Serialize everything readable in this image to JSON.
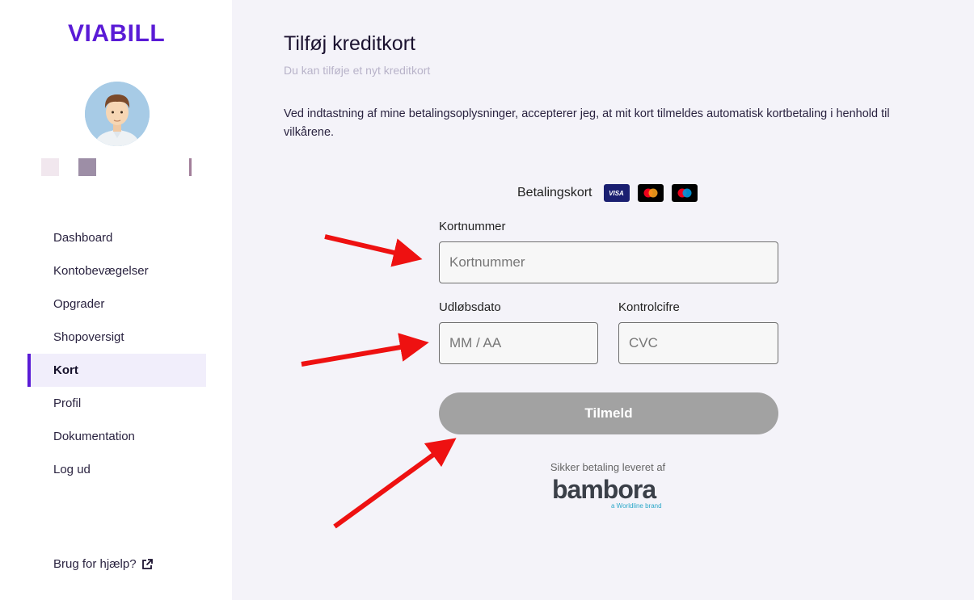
{
  "brand": {
    "logo_text": "VIABILL",
    "accent_color": "#5a1bd6"
  },
  "sidebar": {
    "nav": [
      {
        "label": "Dashboard"
      },
      {
        "label": "Kontobevægelser"
      },
      {
        "label": "Opgrader"
      },
      {
        "label": "Shopoversigt"
      },
      {
        "label": "Kort",
        "active": true
      },
      {
        "label": "Profil"
      },
      {
        "label": "Dokumentation"
      },
      {
        "label": "Log ud"
      }
    ],
    "help_label": "Brug for hjælp?"
  },
  "main": {
    "title": "Tilføj kreditkort",
    "subtitle": "Du kan tilføje et nyt kreditkort",
    "terms": "Ved indtastning af mine betalingsoplysninger, accepterer jeg, at mit kort tilmeldes automatisk kortbetaling i henhold til vilkårene."
  },
  "payment_form": {
    "card_section_label": "Betalingskort",
    "card_logos": [
      "visa-logo",
      "mastercard-logo",
      "maestro-logo"
    ],
    "visa_text": "VISA",
    "card_number": {
      "label": "Kortnummer",
      "placeholder": "Kortnummer"
    },
    "expiry": {
      "label": "Udløbsdato",
      "placeholder": "MM / AA"
    },
    "cvc": {
      "label": "Kontrolcifre",
      "placeholder": "CVC"
    },
    "submit_label": "Tilmeld",
    "secure_text": "Sikker betaling leveret af",
    "provider_name": "bambora",
    "provider_tagline": "a Worldline brand"
  }
}
